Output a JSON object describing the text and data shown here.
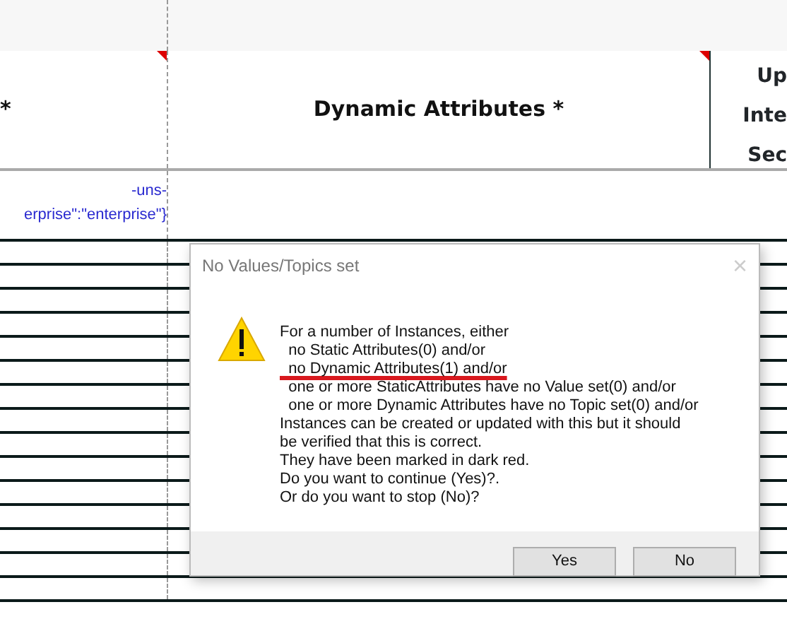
{
  "table": {
    "columns": [
      {
        "label": "*",
        "corner_note": true
      },
      {
        "label": "Dynamic Attributes *",
        "corner_note": true
      },
      {
        "label_lines": [
          "Up",
          "Inte",
          "Sec"
        ],
        "corner_note": false
      }
    ],
    "rows": [
      {
        "cells": [
          {
            "lines": [
              "-uns-",
              "erprise\":\"enterprise\"}"
            ]
          },
          {}
        ]
      }
    ]
  },
  "dialog": {
    "title": "No Values/Topics set",
    "close": "×",
    "message_lines": [
      {
        "text": "For a number of Instances, either",
        "underlined": false
      },
      {
        "text": "  no Static Attributes(0) and/or",
        "underlined": false
      },
      {
        "text": "  no Dynamic Attributes(1) and/or",
        "underlined": true
      },
      {
        "text": "  one or more StaticAttributes have no Value set(0) and/or",
        "underlined": false
      },
      {
        "text": "  one or more Dynamic Attributes have no Topic set(0) and/or",
        "underlined": false
      },
      {
        "text": "Instances can be created or updated with this but it should",
        "underlined": false
      },
      {
        "text": "be verified that this is correct.",
        "underlined": false
      },
      {
        "text": "They have been marked in dark red.",
        "underlined": false
      },
      {
        "text": "Do you want to continue (Yes)?.",
        "underlined": false
      },
      {
        "text": "Or do you want to stop (No)?",
        "underlined": false
      }
    ],
    "buttons": [
      "Yes",
      "No"
    ]
  }
}
